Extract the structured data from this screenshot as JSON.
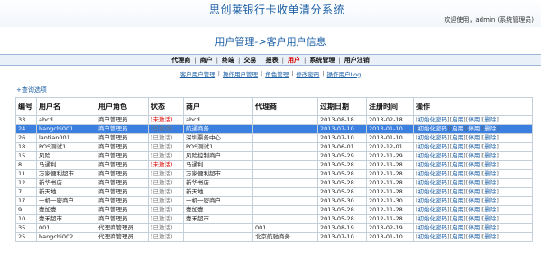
{
  "header": {
    "system_title": "思创莱银行卡收单清分系统",
    "welcome": "欢迎使用，admin (系统管理员)"
  },
  "page": {
    "heading": "用户管理->客户用户信息"
  },
  "main_nav": [
    {
      "label": "代理商",
      "active": false
    },
    {
      "label": "商户",
      "active": false
    },
    {
      "label": "终端",
      "active": false
    },
    {
      "label": "交易",
      "active": false
    },
    {
      "label": "报表",
      "active": false
    },
    {
      "label": "用户",
      "active": true
    },
    {
      "label": "系统管理",
      "active": false
    },
    {
      "label": "用户注销",
      "active": false
    }
  ],
  "sub_nav": [
    "客户用户管理",
    "操作用户管理",
    "角色管理",
    "修改密码",
    "操作用户Log"
  ],
  "query": {
    "label": "+查询选项"
  },
  "table": {
    "headers": [
      "编号",
      "用户名",
      "用户角色",
      "状态",
      "商户",
      "代理商",
      "过期日期",
      "注册时间",
      "操作"
    ],
    "actions": [
      "初始化密码",
      "启用",
      "停用",
      "删除"
    ],
    "rows": [
      {
        "id": "33",
        "user": "abcd",
        "role": "商户管理员",
        "status": "(未激活)",
        "status_kind": "inactive",
        "merchant": "abcd",
        "agent": "",
        "expire": "2013-08-18",
        "register": "2013-02-18",
        "selected": false
      },
      {
        "id": "24",
        "user": "hangchi001",
        "role": "商户管理员",
        "status": "(已激活)",
        "status_kind": "active",
        "merchant": "航通商务",
        "agent": "",
        "expire": "2013-07-10",
        "register": "2013-01-10",
        "selected": true
      },
      {
        "id": "26",
        "user": "lantian001",
        "role": "商户管理员",
        "status": "(已激活)",
        "status_kind": "active",
        "merchant": "深圳票务中心",
        "agent": "",
        "expire": "2013-07-10",
        "register": "2013-01-10",
        "selected": false
      },
      {
        "id": "18",
        "user": "POS测试1",
        "role": "商户管理员",
        "status": "(已激活)",
        "status_kind": "active",
        "merchant": "POS测试1",
        "agent": "",
        "expire": "2013-06-01",
        "register": "2012-12-01",
        "selected": false
      },
      {
        "id": "15",
        "user": "风险",
        "role": "商户管理员",
        "status": "(已激活)",
        "status_kind": "active",
        "merchant": "风险控制商户",
        "agent": "",
        "expire": "2013-05-29",
        "register": "2012-11-29",
        "selected": false
      },
      {
        "id": "8",
        "user": "马通利",
        "role": "商户管理员",
        "status": "(未激活)",
        "status_kind": "inactive",
        "merchant": "马通利",
        "agent": "",
        "expire": "2013-05-28",
        "register": "2012-11-28",
        "selected": false
      },
      {
        "id": "11",
        "user": "万家便利超市",
        "role": "商户管理员",
        "status": "(已激活)",
        "status_kind": "active",
        "merchant": "万家便利超市",
        "agent": "",
        "expire": "2013-05-28",
        "register": "2012-11-28",
        "selected": false
      },
      {
        "id": "12",
        "user": "新华书店",
        "role": "商户管理员",
        "status": "(已激活)",
        "status_kind": "active",
        "merchant": "新华书店",
        "agent": "",
        "expire": "2013-05-28",
        "register": "2012-11-28",
        "selected": false
      },
      {
        "id": "7",
        "user": "新天地",
        "role": "商户管理员",
        "status": "(已激活)",
        "status_kind": "active",
        "merchant": "新天地",
        "agent": "",
        "expire": "2013-05-28",
        "register": "2012-11-28",
        "selected": false
      },
      {
        "id": "17",
        "user": "一机一密商户",
        "role": "商户管理员",
        "status": "(已激活)",
        "status_kind": "active",
        "merchant": "一机一密商户",
        "agent": "",
        "expire": "2013-05-30",
        "register": "2012-11-30",
        "selected": false
      },
      {
        "id": "9",
        "user": "壹加壹",
        "role": "商户管理员",
        "status": "(已激活)",
        "status_kind": "active",
        "merchant": "壹加壹",
        "agent": "",
        "expire": "2013-05-28",
        "register": "2012-11-28",
        "selected": false
      },
      {
        "id": "10",
        "user": "壹禾超市",
        "role": "商户管理员",
        "status": "(已激活)",
        "status_kind": "active",
        "merchant": "壹禾超市",
        "agent": "",
        "expire": "2013-05-28",
        "register": "2012-11-28",
        "selected": false
      },
      {
        "id": "35",
        "user": "001",
        "role": "代理商管理员",
        "status": "(已激活)",
        "status_kind": "active",
        "merchant": "",
        "agent": "001",
        "expire": "2013-08-19",
        "register": "2013-02-19",
        "selected": false
      },
      {
        "id": "25",
        "user": "hangchi002",
        "role": "代理商管理员",
        "status": "(已激活)",
        "status_kind": "active",
        "merchant": "",
        "agent": "北京航驰商务",
        "expire": "2013-07-10",
        "register": "2013-01-10",
        "selected": false
      }
    ]
  }
}
